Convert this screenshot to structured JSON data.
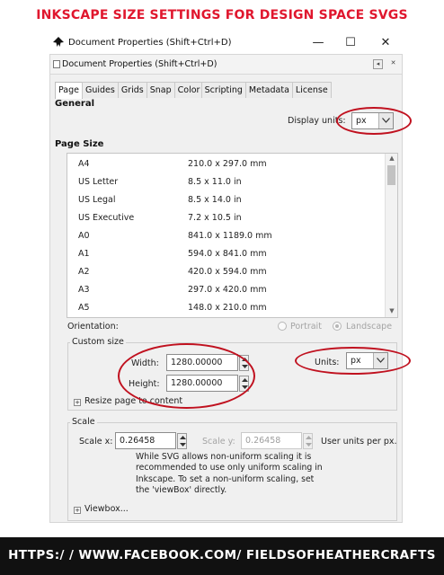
{
  "banner": {
    "title": "INKSCAPE SIZE SETTINGS FOR DESIGN SPACE SVGS"
  },
  "window": {
    "title": "Document Properties (Shift+Ctrl+D)",
    "minimize": "—",
    "maximize": "☐",
    "close": "✕"
  },
  "dock": {
    "title": "Document Properties (Shift+Ctrl+D)",
    "btn_left": "◂",
    "btn_close": "✕"
  },
  "tabs": [
    "Page",
    "Guides",
    "Grids",
    "Snap",
    "Color",
    "Scripting",
    "Metadata",
    "License"
  ],
  "general": {
    "heading": "General",
    "display_units_label": "Display units:",
    "display_units_value": "px"
  },
  "page_size": {
    "heading": "Page Size",
    "rows": [
      {
        "name": "A4",
        "dims": "210.0 x 297.0 mm"
      },
      {
        "name": "US Letter",
        "dims": "8.5 x 11.0 in"
      },
      {
        "name": "US Legal",
        "dims": "8.5 x 14.0 in"
      },
      {
        "name": "US Executive",
        "dims": "7.2 x 10.5 in"
      },
      {
        "name": "A0",
        "dims": "841.0 x 1189.0 mm"
      },
      {
        "name": "A1",
        "dims": "594.0 x 841.0 mm"
      },
      {
        "name": "A2",
        "dims": "420.0 x 594.0 mm"
      },
      {
        "name": "A3",
        "dims": "297.0 x 420.0 mm"
      },
      {
        "name": "A5",
        "dims": "148.0 x 210.0 mm"
      }
    ]
  },
  "orientation": {
    "label": "Orientation:",
    "portrait": "Portrait",
    "landscape": "Landscape"
  },
  "custom_size": {
    "legend": "Custom size",
    "width_label": "Width:",
    "width_value": "1280.00000",
    "height_label": "Height:",
    "height_value": "1280.00000",
    "units_label": "Units:",
    "units_value": "px",
    "resize_label": "Resize page to content"
  },
  "scale": {
    "legend": "Scale",
    "scale_x_label": "Scale x:",
    "scale_x_value": "0.26458",
    "scale_y_label": "Scale y:",
    "scale_y_value": "0.26458",
    "units_text": "User units per px.",
    "note": "While SVG allows non-uniform scaling it is recommended to use only uniform scaling in Inkscape. To set a non-uniform scaling, set the 'viewBox' directly.",
    "viewbox_label": "Viewbox..."
  },
  "footer": {
    "text": "HTTPS:/ / WWW.FACEBOOK.COM/ FIELDSOFHEATHERCRAFTS"
  },
  "colors": {
    "accent_red": "#c0111f",
    "banner_red": "#e0172e"
  }
}
